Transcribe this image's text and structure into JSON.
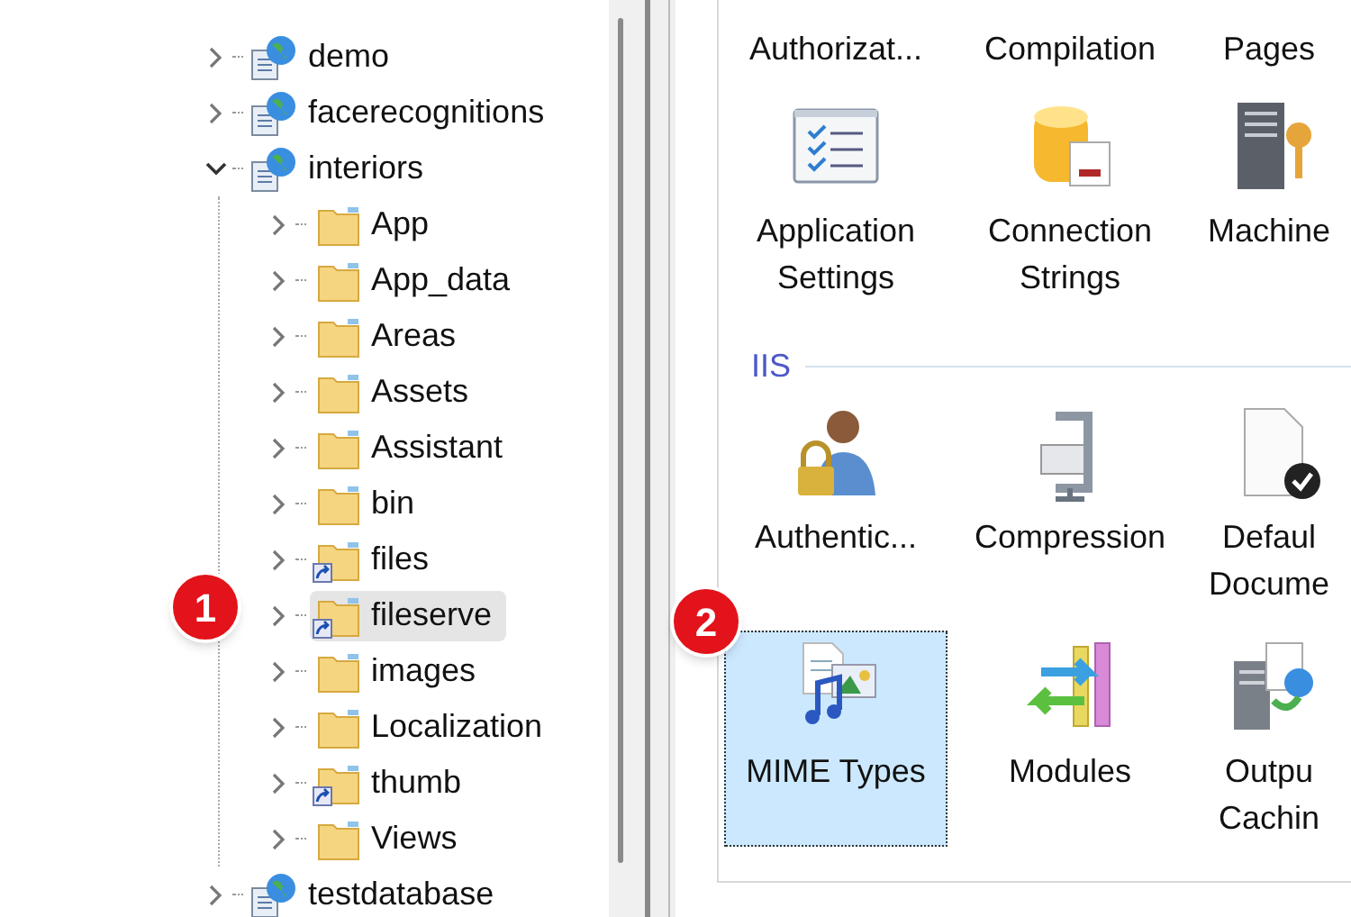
{
  "tree": [
    {
      "label": "demo",
      "kind": "site",
      "expanded": false
    },
    {
      "label": "facerecognitions",
      "kind": "site",
      "expanded": false
    },
    {
      "label": "interiors",
      "kind": "site",
      "expanded": true,
      "children": [
        {
          "label": "App",
          "kind": "folder",
          "selected": false
        },
        {
          "label": "App_data",
          "kind": "folder",
          "selected": false
        },
        {
          "label": "Areas",
          "kind": "folder",
          "selected": false
        },
        {
          "label": "Assets",
          "kind": "folder",
          "selected": false
        },
        {
          "label": "Assistant",
          "kind": "folder",
          "selected": false
        },
        {
          "label": "bin",
          "kind": "folder",
          "selected": false
        },
        {
          "label": "files",
          "kind": "shortcut",
          "selected": false
        },
        {
          "label": "fileserve",
          "kind": "shortcut",
          "selected": true
        },
        {
          "label": "images",
          "kind": "folder",
          "selected": false
        },
        {
          "label": "Localization",
          "kind": "folder",
          "selected": false
        },
        {
          "label": "thumb",
          "kind": "shortcut",
          "selected": false
        },
        {
          "label": "Views",
          "kind": "folder",
          "selected": false
        }
      ]
    },
    {
      "label": "testdatabase",
      "kind": "site",
      "expanded": false
    }
  ],
  "callouts": [
    "1",
    "2"
  ],
  "features": {
    "top_labels": [
      "Authorizat...",
      "Compilation",
      "Pages"
    ],
    "sections": [
      {
        "items": [
          {
            "label": [
              "Application",
              "Settings"
            ],
            "kind": "checklist",
            "selected": false
          },
          {
            "label": [
              "Connection",
              "Strings"
            ],
            "kind": "database",
            "selected": false
          },
          {
            "label": [
              "Machine"
            ],
            "kind": "server-key",
            "selected": false
          }
        ]
      },
      {
        "header": "IIS",
        "items": [
          {
            "label": [
              "Authentic..."
            ],
            "kind": "user-lock",
            "selected": false
          },
          {
            "label": [
              "Compression"
            ],
            "kind": "clamp",
            "selected": false
          },
          {
            "label": [
              "Defaul",
              "Docume"
            ],
            "kind": "document",
            "selected": false
          }
        ]
      },
      {
        "items": [
          {
            "label": [
              "MIME Types"
            ],
            "kind": "mime",
            "selected": true
          },
          {
            "label": [
              "Modules"
            ],
            "kind": "modules",
            "selected": false
          },
          {
            "label": [
              "Outpu",
              "Cachin"
            ],
            "kind": "server-cache",
            "selected": false
          }
        ]
      }
    ]
  }
}
